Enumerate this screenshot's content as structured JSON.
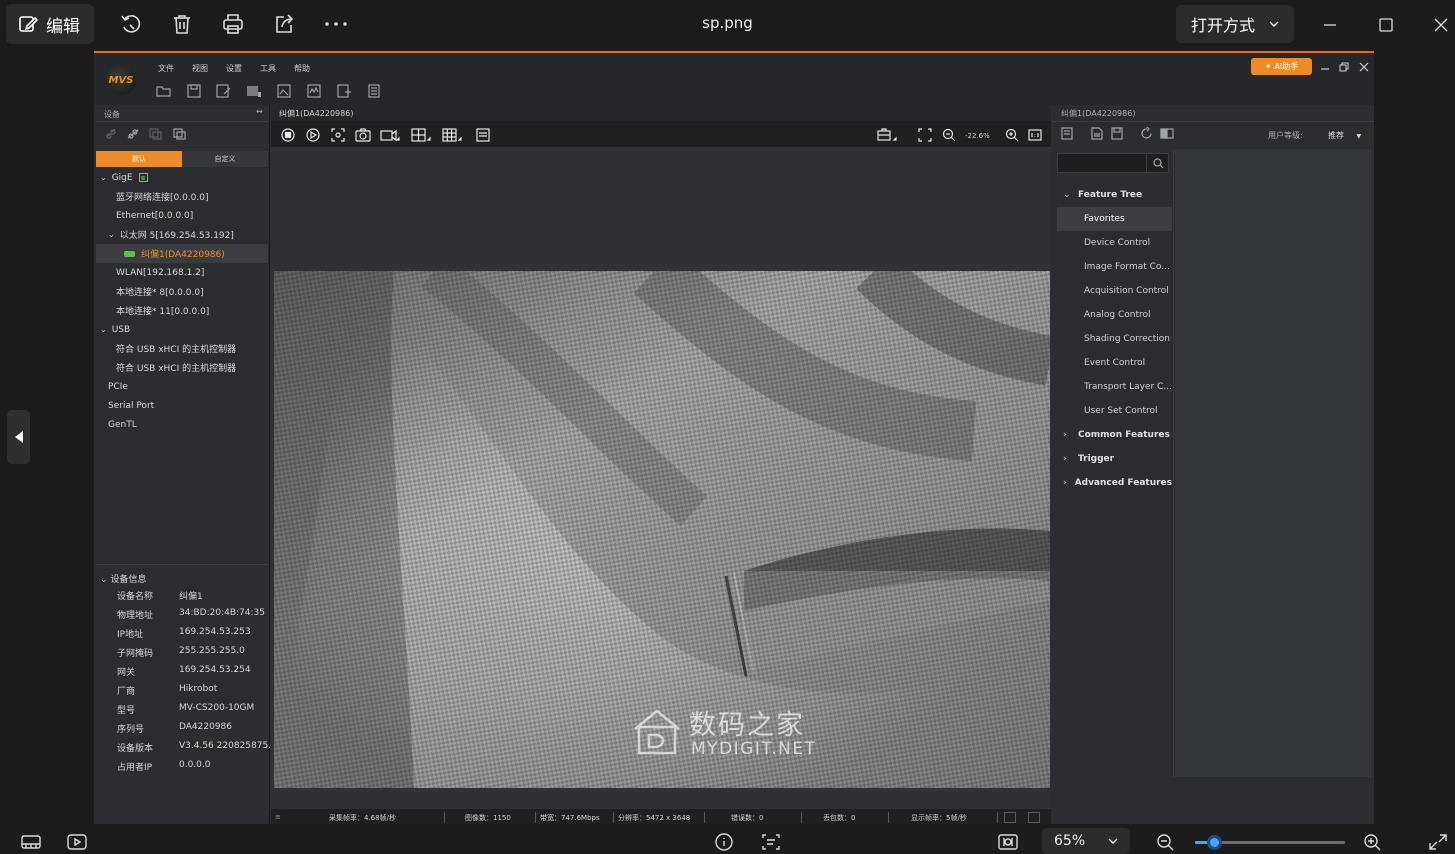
{
  "viewer": {
    "edit_label": "编辑",
    "file_name": "sp.png",
    "open_with_label": "打开方式",
    "zoom_value": "65%",
    "zoom_slider_fraction": 0.13
  },
  "mvs": {
    "menu": [
      "文件",
      "视图",
      "设置",
      "工具",
      "帮助"
    ],
    "ai_button": "AI助手",
    "left": {
      "title": "设备",
      "tabs": {
        "default": "默认",
        "custom": "自定义"
      },
      "tree": [
        {
          "label": "GigE",
          "indent": 0,
          "expander": "v"
        },
        {
          "label": "蓝牙网络连接[0.0.0.0]",
          "indent": 2,
          "expander": ""
        },
        {
          "label": "Ethernet[0.0.0.0]",
          "indent": 2,
          "expander": ""
        },
        {
          "label": "以太网 5[169.254.53.192]",
          "indent": 1,
          "expander": "v"
        },
        {
          "label": "纠偏1(DA4220986)",
          "indent": 3,
          "expander": "",
          "selected": true
        },
        {
          "label": "WLAN[192.168.1.2]",
          "indent": 2,
          "expander": ""
        },
        {
          "label": "本地连接* 8[0.0.0.0]",
          "indent": 2,
          "expander": ""
        },
        {
          "label": "本地连接* 11[0.0.0.0]",
          "indent": 2,
          "expander": ""
        },
        {
          "label": "USB",
          "indent": 0,
          "expander": "v"
        },
        {
          "label": "符合 USB xHCI 的主机控制器",
          "indent": 2,
          "expander": ""
        },
        {
          "label": "符合 USB xHCI 的主机控制器",
          "indent": 2,
          "expander": ""
        },
        {
          "label": "PCIe",
          "indent": 1,
          "expander": ""
        },
        {
          "label": "Serial Port",
          "indent": 1,
          "expander": ""
        },
        {
          "label": "GenTL",
          "indent": 1,
          "expander": ""
        }
      ],
      "info_title": "设备信息",
      "info": [
        {
          "k": "设备名称",
          "v": "纠偏1"
        },
        {
          "k": "物理地址",
          "v": "34:BD:20:4B:74:35"
        },
        {
          "k": "IP地址",
          "v": "169.254.53.253"
        },
        {
          "k": "子网掩码",
          "v": "255.255.255.0"
        },
        {
          "k": "网关",
          "v": "169.254.53.254"
        },
        {
          "k": "厂商",
          "v": "Hikrobot"
        },
        {
          "k": "型号",
          "v": "MV-CS200-10GM"
        },
        {
          "k": "序列号",
          "v": "DA4220986"
        },
        {
          "k": "设备版本",
          "v": "V3.4.56 220825875..."
        },
        {
          "k": "占用者IP",
          "v": "0.0.0.0"
        }
      ]
    },
    "center": {
      "tab": "纠偏1(DA4220986)",
      "zoom": "-22.6%",
      "status": {
        "capture_rate": "采集帧率：4.68帧/秒",
        "image_count": "图像数：1150",
        "bandwidth": "带宽：747.6Mbps",
        "resolution": "分辨率：5472 x 3648",
        "errors": "错误数：0",
        "lost": "丢包数：0",
        "display_rate": "显示帧率：5帧/秒"
      }
    },
    "right": {
      "tab": "纠偏1(DA4220986)",
      "user_level_label": "用户等级:",
      "user_level": "推荐",
      "feature_tree": [
        {
          "label": "Feature Tree",
          "group": true,
          "expander": "v"
        },
        {
          "label": "Favorites",
          "group": false,
          "selected": true
        },
        {
          "label": "Device Control",
          "group": false
        },
        {
          "label": "Image Format Co...",
          "group": false
        },
        {
          "label": "Acquisition Control",
          "group": false
        },
        {
          "label": "Analog Control",
          "group": false
        },
        {
          "label": "Shading Correction",
          "group": false
        },
        {
          "label": "Event Control",
          "group": false
        },
        {
          "label": "Transport Layer C...",
          "group": false
        },
        {
          "label": "User Set Control",
          "group": false
        },
        {
          "label": "Common Features",
          "group": true,
          "expander": ">"
        },
        {
          "label": "Trigger",
          "group": true,
          "expander": ">"
        },
        {
          "label": "Advanced Features",
          "group": true,
          "expander": ">"
        }
      ]
    }
  },
  "watermark": {
    "cn": "数码之家",
    "en": "MYDIGIT.NET"
  }
}
